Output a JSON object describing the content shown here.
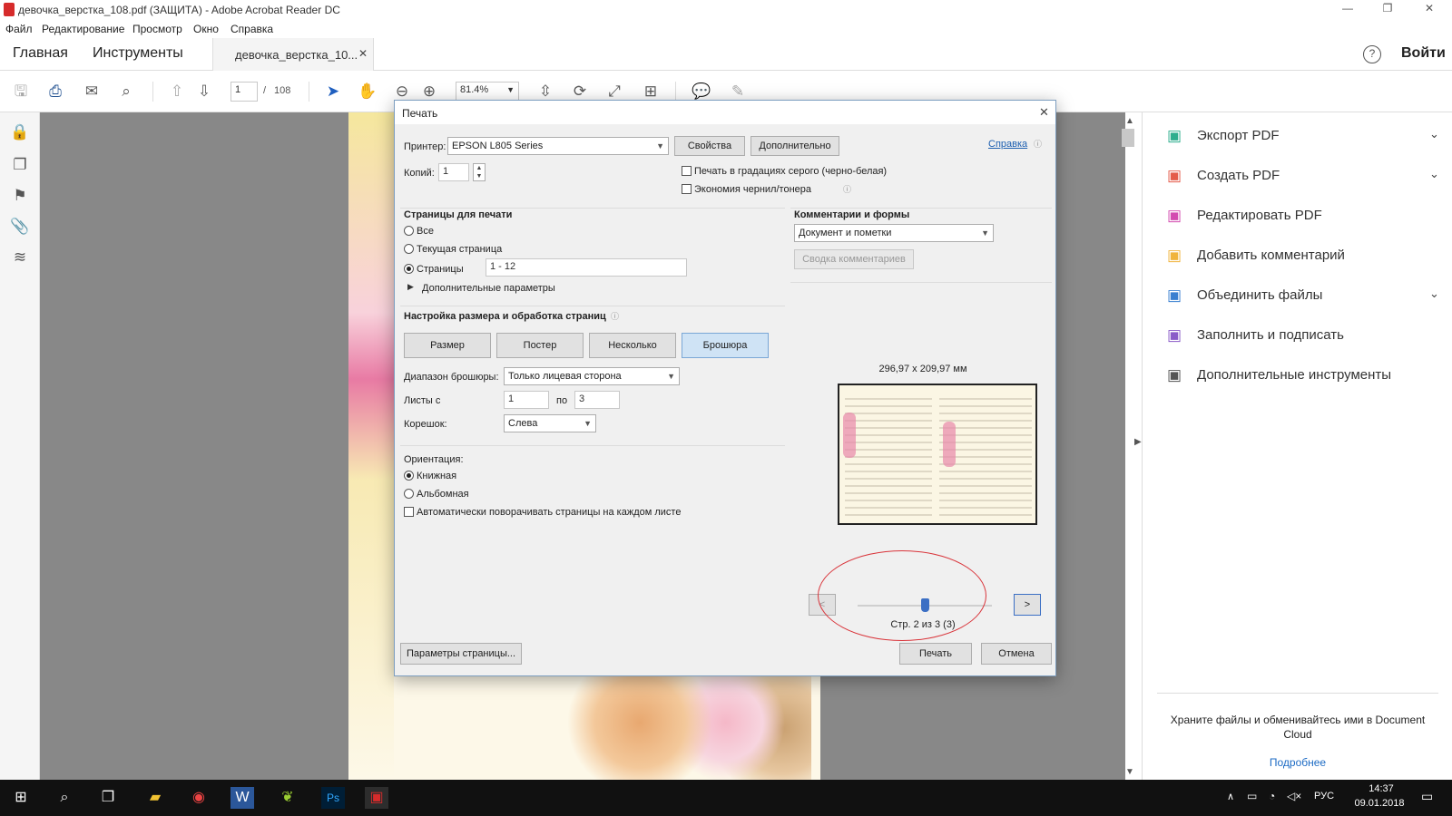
{
  "window": {
    "title": "девочка_верстка_108.pdf (ЗАЩИТА) - Adobe Acrobat Reader DC"
  },
  "menu": [
    "Файл",
    "Редактирование",
    "Просмотр",
    "Окно",
    "Справка"
  ],
  "tabs": {
    "home": "Главная",
    "tools": "Инструменты",
    "document": "девочка_верстка_10...",
    "signin": "Войти"
  },
  "toolbar": {
    "page_current": "1",
    "page_sep": "/",
    "page_total": "108",
    "zoom": "81.4%"
  },
  "right_pane": {
    "items": [
      {
        "label": "Экспорт PDF",
        "icon": "export-pdf-icon",
        "color": "#2fae8e",
        "chevron": true
      },
      {
        "label": "Создать PDF",
        "icon": "create-pdf-icon",
        "color": "#e45c4b",
        "chevron": true
      },
      {
        "label": "Редактировать PDF",
        "icon": "edit-pdf-icon",
        "color": "#d34bb0",
        "chevron": false
      },
      {
        "label": "Добавить комментарий",
        "icon": "comment-icon",
        "color": "#f0b43c",
        "chevron": false
      },
      {
        "label": "Объединить файлы",
        "icon": "combine-files-icon",
        "color": "#3a7fd0",
        "chevron": true
      },
      {
        "label": "Заполнить и подписать",
        "icon": "fill-sign-icon",
        "color": "#8a5cc8",
        "chevron": false
      },
      {
        "label": "Дополнительные инструменты",
        "icon": "more-tools-icon",
        "color": "#555555",
        "chevron": false
      }
    ],
    "cloud_text": "Храните файлы и обменивайтесь ими в Document Cloud",
    "cloud_link": "Подробнее"
  },
  "dialog": {
    "title": "Печать",
    "printer_label": "Принтер:",
    "printer_value": "EPSON L805 Series",
    "properties_btn": "Свойства",
    "advanced_btn": "Дополнительно",
    "help_link": "Справка",
    "copies_label": "Копий:",
    "copies_value": "1",
    "grayscale_label": "Печать в градациях серого (черно-белая)",
    "ink_save_label": "Экономия чернил/тонера",
    "pages_section": {
      "title": "Страницы для печати",
      "all": "Все",
      "current": "Текущая страница",
      "pages": "Страницы",
      "pages_value": "1 - 12",
      "more_options": "Дополнительные параметры"
    },
    "sizing_section": {
      "title": "Настройка размера и обработка страниц",
      "tabs": [
        "Размер",
        "Постер",
        "Несколько",
        "Брошюра"
      ],
      "booklet_range_label": "Диапазон брошюры:",
      "booklet_range_value": "Только лицевая сторона",
      "sheets_label": "Листы с",
      "sheets_from": "1",
      "sheets_to_label": "по",
      "sheets_to": "3",
      "binding_label": "Корешок:",
      "binding_value": "Слева"
    },
    "orientation_section": {
      "title": "Ориентация:",
      "portrait": "Книжная",
      "landscape": "Альбомная",
      "auto_rotate": "Автоматически поворачивать страницы на каждом листе"
    },
    "comments_section": {
      "title": "Комментарии и формы",
      "value": "Документ и пометки",
      "summary_btn": "Сводка комментариев"
    },
    "preview": {
      "size": "296,97 x 209,97 мм",
      "page_info": "Стр. 2 из 3 (3)",
      "prev": "<",
      "next": ">",
      "slider_fraction": 0.5
    },
    "page_setup_btn": "Параметры страницы...",
    "print_btn": "Печать",
    "cancel_btn": "Отмена"
  },
  "taskbar": {
    "lang": "РУС",
    "time": "14:37",
    "date": "09.01.2018"
  }
}
